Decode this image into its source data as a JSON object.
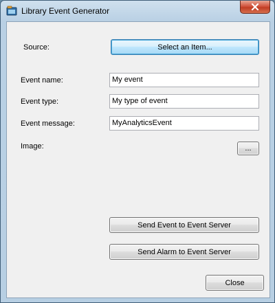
{
  "window": {
    "title": "Library Event Generator",
    "close_glyph": "✕"
  },
  "form": {
    "source_label": "Source:",
    "select_button_label": "Select an Item...",
    "event_name_label": "Event name:",
    "event_name_value": "My event",
    "event_type_label": "Event type:",
    "event_type_value": "My type of event",
    "event_message_label": "Event message:",
    "event_message_value": "MyAnalyticsEvent",
    "image_label": "Image:",
    "image_browse_label": "..."
  },
  "actions": {
    "send_event_label": "Send Event to Event Server",
    "send_alarm_label": "Send Alarm to Event Server",
    "close_label": "Close"
  },
  "icons": {
    "app": "application-window-icon",
    "close": "close-icon"
  },
  "colors": {
    "accent_default_border": "#3c7fb1",
    "close_button_red": "#c13d24"
  }
}
